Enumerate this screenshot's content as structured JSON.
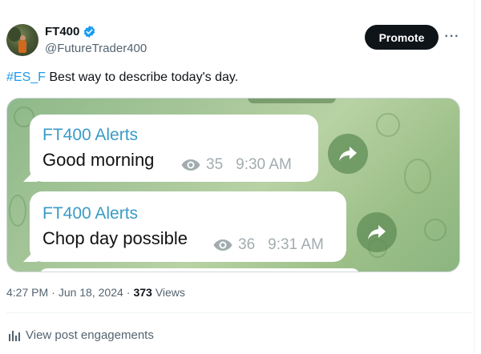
{
  "author": {
    "display_name": "FT400",
    "handle": "@FutureTrader400"
  },
  "actions": {
    "promote_label": "Promote",
    "more_label": "···"
  },
  "tweet": {
    "hashtag": "#ES_F",
    "text": " Best way to describe today's day."
  },
  "media": {
    "messages": [
      {
        "sender": "FT400 Alerts",
        "text": "Good morning",
        "views": "35",
        "time": "9:30 AM"
      },
      {
        "sender": "FT400 Alerts",
        "text": "Chop day possible",
        "views": "36",
        "time": "9:31 AM"
      }
    ]
  },
  "footer": {
    "time": "4:27 PM",
    "separator1": "·",
    "date": "Jun 18, 2024",
    "separator2": "·",
    "views_count": "373",
    "views_label": "Views",
    "engagements_label": "View post engagements"
  },
  "colors": {
    "hashtag": "#1d9bf0",
    "verified": "#1d9bf0",
    "sender": "#3a9bc7",
    "promote_bg": "#0f1419"
  },
  "icons": [
    "verified-badge-icon",
    "more-icon",
    "eye-icon",
    "forward-icon",
    "bar-chart-icon"
  ]
}
